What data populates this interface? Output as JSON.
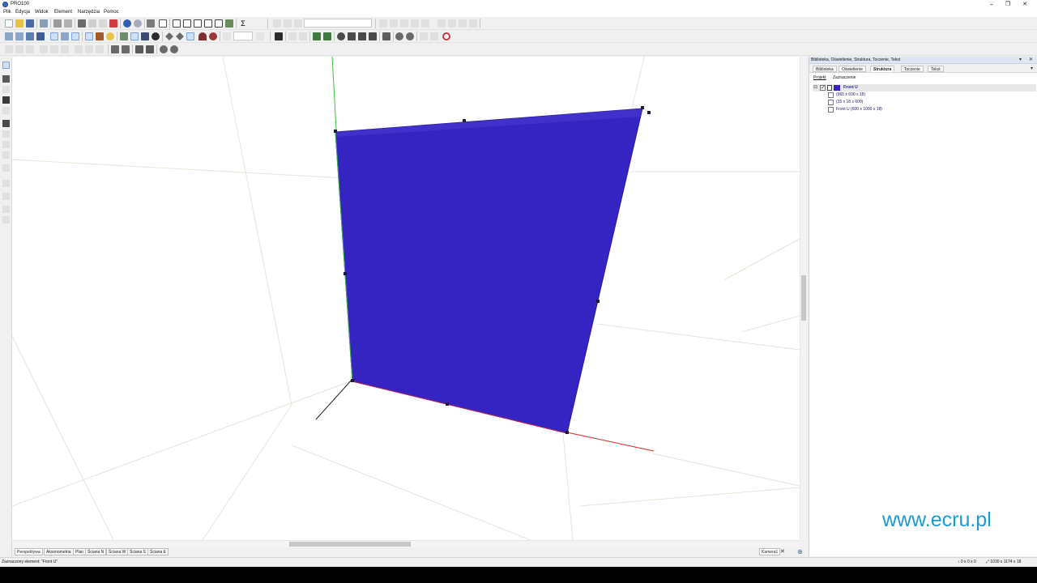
{
  "window": {
    "title": "PRO100",
    "buttons": {
      "minimize": "–",
      "restore": "❐",
      "close": "✕"
    }
  },
  "menu": [
    "Plik",
    "Edycja",
    "Widok",
    "Element",
    "Narzędzia",
    "Pomoc"
  ],
  "view_tabs": [
    "Perspektywa",
    "Aksonometria",
    "Plan",
    "Ściana N",
    "Ściana W",
    "Ściana S",
    "Ściana E"
  ],
  "active_view_tab": "Perspektywa",
  "camera_tab": {
    "label": "Kamera1",
    "close": "✕",
    "add": "⊕"
  },
  "statusbar": {
    "selected": "Zaznaczony element: \"Front U\"",
    "position": "↕ 0 x 0 x 0",
    "size": "⤢ 1030 x 1174 x 18"
  },
  "panel": {
    "title": "Biblioteka, Oświetlenie, Struktura, Toczenie, Tekst",
    "pin": "▾",
    "close": "✕",
    "dropdown": "▾",
    "tabs": [
      "Biblioteka",
      "Oświetlenie",
      "Struktura",
      "Toczenie",
      "Tekst"
    ],
    "active_tab": "Struktura",
    "subtabs": [
      "Projekt",
      "Zaznaczenie"
    ],
    "active_subtab": "Projekt",
    "tree": {
      "root": {
        "label": "Front U",
        "expander": "⊟"
      },
      "children": [
        {
          "label": "(965 x 600 x 18)"
        },
        {
          "label": "(35 x 18 x 600)"
        },
        {
          "label": "Front U   (600 x 1000 x 18)"
        }
      ]
    }
  },
  "watermark": "www.ecru.pl",
  "colors": {
    "panel_fill": "#3524c2",
    "axis_x": "#cc2a2a",
    "axis_y": "#33cc33",
    "axis_z": "#222222",
    "watermark": "#1a9bd3",
    "tree_text": "#1a1a6e"
  },
  "icons": {
    "toolbar_row1": [
      "new-file-icon",
      "open-file-icon",
      "save-icon",
      "export-icon",
      "print-icon",
      "print-preview-icon",
      "cut-icon",
      "copy-icon",
      "paste-icon",
      "delete-icon",
      "globe-icon",
      "sphere-icon",
      "render-icon",
      "window-icon",
      "page-icon",
      "page-icon",
      "page-icon",
      "page-icon",
      "page-icon",
      "sum-icon"
    ],
    "toolbar_row2": [
      "cube-icon",
      "cube-icon",
      "cube-icon",
      "cube-icon",
      "cube-icon",
      "cube-icon",
      "cube-icon",
      "cube-icon",
      "pointer-icon",
      "brush-icon",
      "bulb-icon",
      "link-icon",
      "measure-icon",
      "grid-icon",
      "eye-icon",
      "diamond-icon",
      "diamond-icon",
      "camera-icon",
      "magnet-icon",
      "stop-icon"
    ]
  }
}
